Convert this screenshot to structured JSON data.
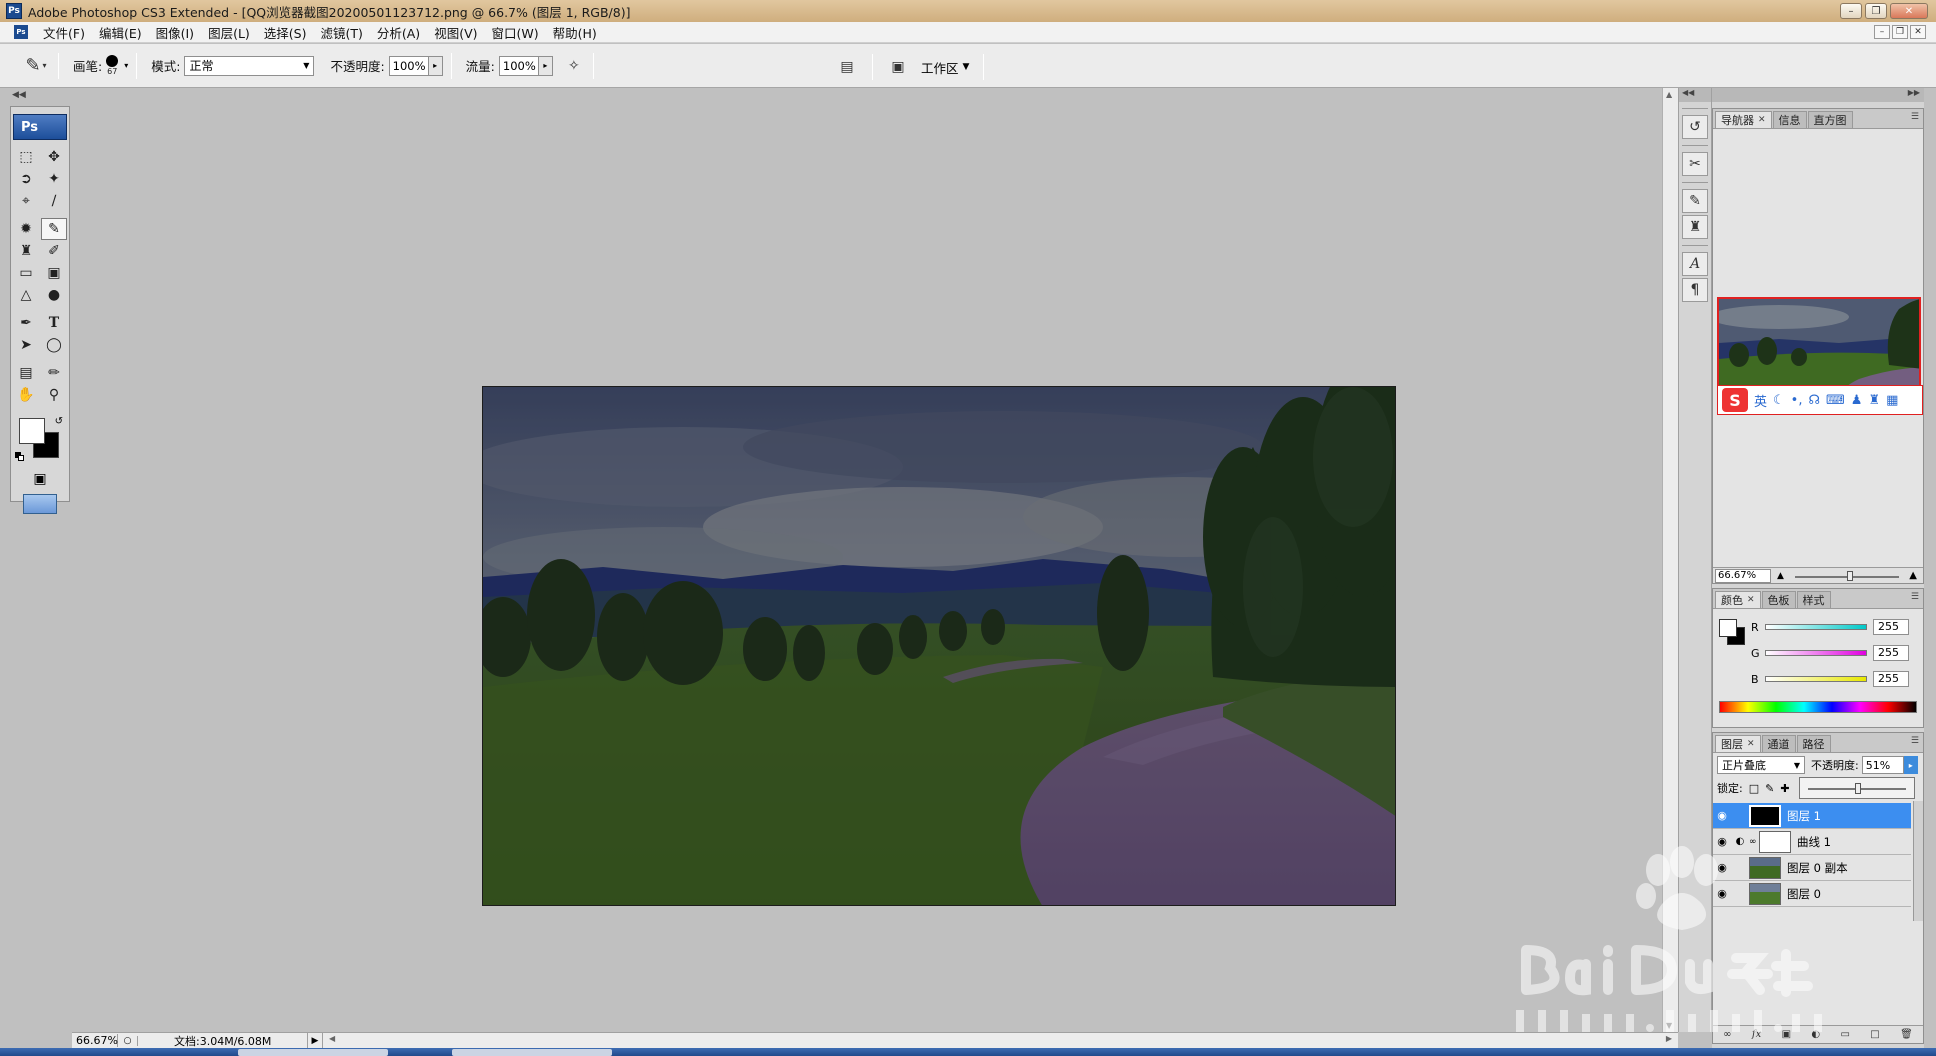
{
  "app": {
    "title": "Adobe Photoshop CS3 Extended - [QQ浏览器截图20200501123712.png @ 66.7% (图层 1, RGB/8)]",
    "logo": "Ps",
    "logo_small": "Ps"
  },
  "menu": [
    "文件(F)",
    "编辑(E)",
    "图像(I)",
    "图层(L)",
    "选择(S)",
    "滤镜(T)",
    "分析(A)",
    "视图(V)",
    "窗口(W)",
    "帮助(H)"
  ],
  "options": {
    "brush_label": "画笔:",
    "brush_size": "67",
    "mode_label": "模式:",
    "mode_value": "正常",
    "opacity_label": "不透明度:",
    "opacity_value": "100%",
    "flow_label": "流量:",
    "flow_value": "100%",
    "workspace_label": "工作区"
  },
  "status": {
    "zoom": "66.67%",
    "doc_info": "文档:3.04M/6.08M"
  },
  "navigator": {
    "tabs": [
      "导航器",
      "信息",
      "直方图"
    ],
    "zoom": "66.67%",
    "ime_label": "英"
  },
  "color_panel": {
    "tabs": [
      "颜色",
      "色板",
      "样式"
    ],
    "channels": [
      {
        "label": "R",
        "value": "255",
        "gradient": [
          "#ffffff",
          "#00c8c8"
        ]
      },
      {
        "label": "G",
        "value": "255",
        "gradient": [
          "#ffffff",
          "#e000e0"
        ]
      },
      {
        "label": "B",
        "value": "255",
        "gradient": [
          "#ffffff",
          "#e8e800"
        ]
      }
    ]
  },
  "layers_panel": {
    "tabs": [
      "图层",
      "通道",
      "路径"
    ],
    "blend_mode": "正片叠底",
    "opacity_label": "不透明度:",
    "opacity_value": "51%",
    "opacity_level": 0.51,
    "lock_label": "锁定:",
    "layers": [
      {
        "name": "图层 1",
        "selected": true
      },
      {
        "name": "曲线 1",
        "selected": false
      },
      {
        "name": "图层 0 副本",
        "selected": false
      },
      {
        "name": "图层 0",
        "selected": false
      }
    ]
  },
  "colors": {
    "accent": "#3c8ef0",
    "brand": "#1b4a8f"
  }
}
